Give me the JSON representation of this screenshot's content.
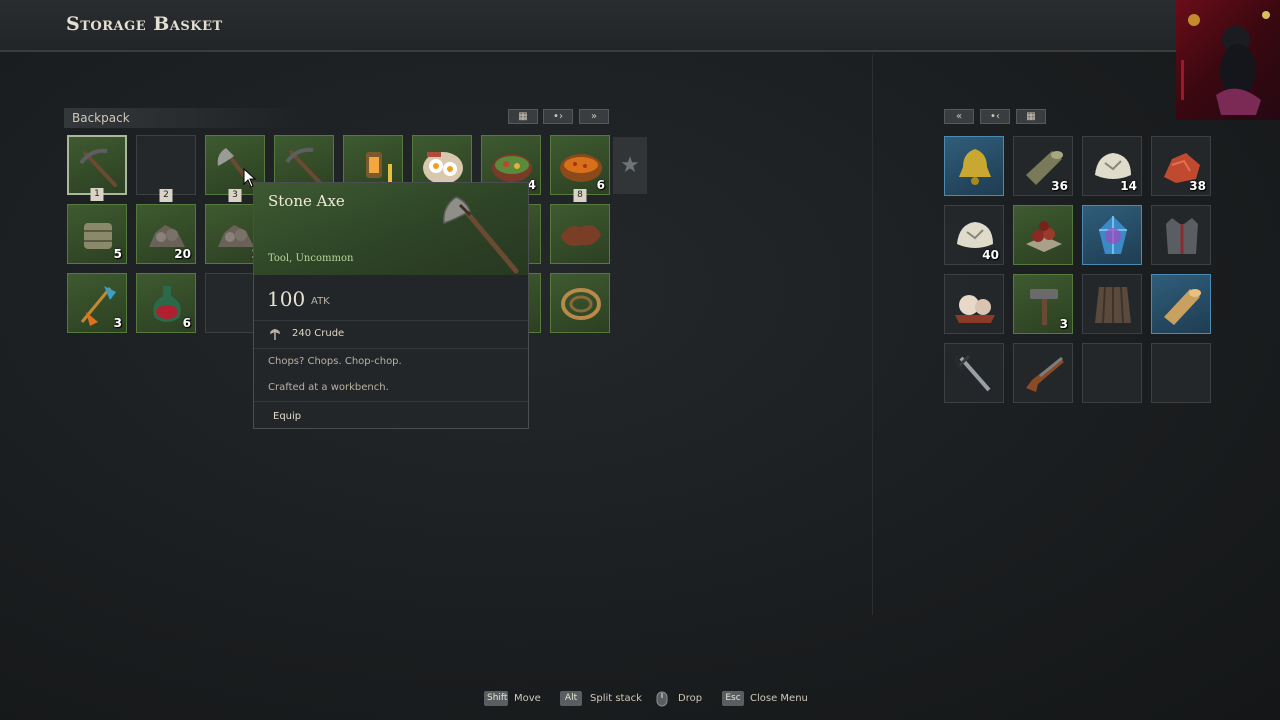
{
  "header": {
    "title": "Storage Basket"
  },
  "backpack": {
    "label": "Backpack",
    "tab_buttons": [
      "▦",
      "•›",
      "»"
    ],
    "slots": [
      {
        "icon": "pickaxe-icon",
        "count": "",
        "hotkey": "1",
        "rarity": "green",
        "selected": true
      },
      {
        "icon": "",
        "count": "",
        "hotkey": "2",
        "rarity": "empty"
      },
      {
        "icon": "stone-axe-icon",
        "count": "",
        "hotkey": "3",
        "rarity": "green"
      },
      {
        "icon": "pickaxe-icon",
        "count": "",
        "hotkey": "",
        "rarity": "green"
      },
      {
        "icon": "lantern-icon",
        "count": "",
        "hotkey": "",
        "rarity": "green"
      },
      {
        "icon": "fried-eggs-icon",
        "count": "",
        "hotkey": "",
        "rarity": "green"
      },
      {
        "icon": "salad-bowl-icon",
        "count": "4",
        "hotkey": "",
        "rarity": "green"
      },
      {
        "icon": "stew-pot-icon",
        "count": "6",
        "hotkey": "8",
        "rarity": "green"
      },
      {
        "icon": "wood-bundle-icon",
        "count": "5",
        "hotkey": "",
        "rarity": "green"
      },
      {
        "icon": "stone-pile-icon",
        "count": "20",
        "hotkey": "",
        "rarity": "green"
      },
      {
        "icon": "stone-pile-icon",
        "count": "2",
        "hotkey": "",
        "rarity": "green"
      },
      {
        "icon": "",
        "count": "",
        "hotkey": "",
        "rarity": "empty"
      },
      {
        "icon": "",
        "count": "",
        "hotkey": "",
        "rarity": "empty"
      },
      {
        "icon": "",
        "count": "",
        "hotkey": "",
        "rarity": "empty"
      },
      {
        "icon": "",
        "count": "",
        "hotkey": "",
        "rarity": "green"
      },
      {
        "icon": "animal-hide-icon",
        "count": "",
        "hotkey": "",
        "rarity": "green"
      },
      {
        "icon": "feather-arrows-icon",
        "count": "3",
        "hotkey": "",
        "rarity": "green"
      },
      {
        "icon": "potion-icon",
        "count": "6",
        "hotkey": "",
        "rarity": "green"
      },
      {
        "icon": "",
        "count": "",
        "hotkey": "",
        "rarity": "empty"
      },
      {
        "icon": "",
        "count": "",
        "hotkey": "",
        "rarity": "empty"
      },
      {
        "icon": "",
        "count": "",
        "hotkey": "",
        "rarity": "empty"
      },
      {
        "icon": "",
        "count": "",
        "hotkey": "",
        "rarity": "empty"
      },
      {
        "icon": "",
        "count": "",
        "hotkey": "",
        "rarity": "green"
      },
      {
        "icon": "rope-coil-icon",
        "count": "",
        "hotkey": "",
        "rarity": "green"
      }
    ]
  },
  "storage": {
    "tab_buttons": [
      "«",
      "•‹",
      "▦"
    ],
    "slots": [
      {
        "icon": "bell-icon",
        "count": "",
        "rarity": "blue"
      },
      {
        "icon": "wood-log-icon",
        "count": "36",
        "rarity": "empty"
      },
      {
        "icon": "stone-chunk-icon",
        "count": "14",
        "rarity": "empty"
      },
      {
        "icon": "red-ore-icon",
        "count": "38",
        "rarity": "empty"
      },
      {
        "icon": "stone-chunk-icon",
        "count": "40",
        "rarity": "empty"
      },
      {
        "icon": "berries-icon",
        "count": "",
        "rarity": "green"
      },
      {
        "icon": "crystal-icon",
        "count": "",
        "rarity": "blue"
      },
      {
        "icon": "vest-icon",
        "count": "",
        "rarity": "empty"
      },
      {
        "icon": "pearls-icon",
        "count": "",
        "rarity": "empty"
      },
      {
        "icon": "hammer-icon",
        "count": "3",
        "rarity": "green"
      },
      {
        "icon": "cloth-icon",
        "count": "",
        "rarity": "empty"
      },
      {
        "icon": "gold-roll-icon",
        "count": "",
        "rarity": "blue"
      },
      {
        "icon": "sword-icon",
        "count": "",
        "rarity": "empty"
      },
      {
        "icon": "flintlock-icon",
        "count": "",
        "rarity": "empty"
      },
      {
        "icon": "",
        "count": "",
        "rarity": "empty"
      },
      {
        "icon": "",
        "count": "",
        "rarity": "empty"
      }
    ]
  },
  "tooltip": {
    "name": "Stone Axe",
    "type": "Tool, Uncommon",
    "stat_value": "100",
    "stat_unit": "ATK",
    "crude": "240 Crude",
    "desc1": "Chops? Chops. Chop-chop.",
    "desc2": "Crafted at a workbench.",
    "action": "Equip"
  },
  "hints": [
    {
      "key": "Shift",
      "label": "Move"
    },
    {
      "key": "Alt",
      "label": "Split stack"
    },
    {
      "key": "mouse-icon",
      "label": "Drop"
    },
    {
      "key": "Esc",
      "label": "Close Menu"
    }
  ],
  "colors": {
    "uncommon_green": "#3e5a30",
    "rare_blue": "#2f5d7a",
    "background": "#1b1e20"
  }
}
